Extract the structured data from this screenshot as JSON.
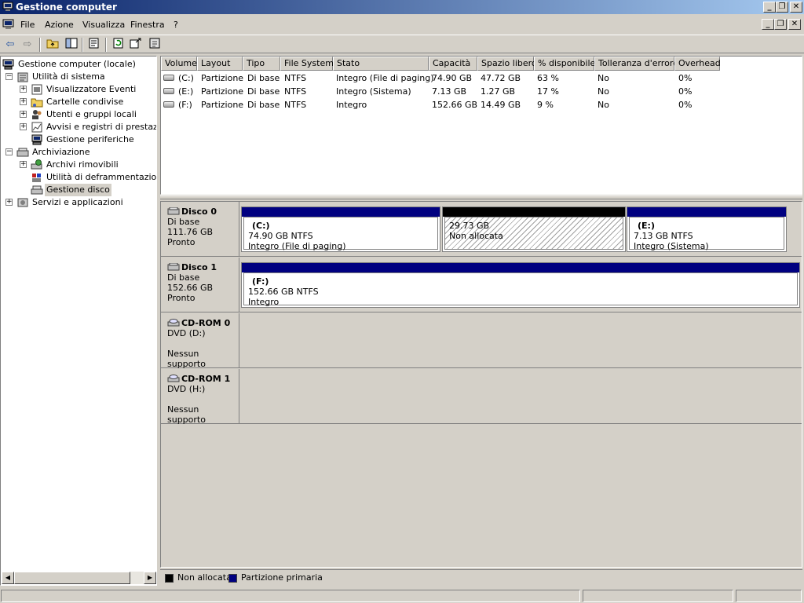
{
  "window": {
    "title": "Gestione computer"
  },
  "menu": {
    "items": [
      "File",
      "Azione",
      "Visualizza",
      "Finestra",
      "?"
    ]
  },
  "toolbar": {
    "buttons": [
      "back-icon",
      "forward-icon",
      "up-folder-icon",
      "show-tree-icon",
      "properties-icon",
      "refresh-icon",
      "export-icon",
      "help-icon"
    ]
  },
  "tree": {
    "root": "Gestione computer (locale)",
    "system_tools": "Utilità di sistema",
    "event_viewer": "Visualizzatore Eventi",
    "shared_folders": "Cartelle condivise",
    "local_users": "Utenti e gruppi locali",
    "perf_logs": "Avvisi e registri di prestazion",
    "device_manager": "Gestione periferiche",
    "storage": "Archiviazione",
    "removable_storage": "Archivi rimovibili",
    "defrag": "Utilità di deframmentazione c",
    "disk_management": "Gestione disco",
    "services": "Servizi e applicazioni"
  },
  "volume_table": {
    "headers": [
      "Volume",
      "Layout",
      "Tipo",
      "File System",
      "Stato",
      "Capacità",
      "Spazio libero",
      "% disponibile",
      "Tolleranza d'errore",
      "Overhead"
    ],
    "rows": [
      [
        "(C:)",
        "Partizione",
        "Di base",
        "NTFS",
        "Integro (File di paging)",
        "74.90 GB",
        "47.72 GB",
        "63 %",
        "No",
        "0%"
      ],
      [
        "(E:)",
        "Partizione",
        "Di base",
        "NTFS",
        "Integro (Sistema)",
        "7.13 GB",
        "1.27 GB",
        "17 %",
        "No",
        "0%"
      ],
      [
        "(F:)",
        "Partizione",
        "Di base",
        "NTFS",
        "Integro",
        "152.66 GB",
        "14.49 GB",
        "9 %",
        "No",
        "0%"
      ]
    ]
  },
  "disks": [
    {
      "name": "Disco 0",
      "type": "Di base",
      "size": "111.76 GB",
      "status": "Pronto",
      "partitions": [
        {
          "label": "(C:)",
          "size": "74.90 GB NTFS",
          "status": "Integro (File di paging)"
        },
        {
          "label": "",
          "size": "29.73 GB",
          "status": "Non allocata"
        },
        {
          "label": "(E:)",
          "size": "7.13 GB NTFS",
          "status": "Integro (Sistema)"
        }
      ]
    },
    {
      "name": "Disco 1",
      "type": "Di base",
      "size": "152.66 GB",
      "status": "Pronto",
      "partitions": [
        {
          "label": "(F:)",
          "size": "152.66 GB NTFS",
          "status": "Integro"
        }
      ]
    },
    {
      "name": "CD-ROM 0",
      "type": "DVD (D:)",
      "size": "",
      "status": "Nessun supporto"
    },
    {
      "name": "CD-ROM 1",
      "type": "DVD (H:)",
      "size": "",
      "status": "Nessun supporto"
    }
  ],
  "legend": {
    "unallocated": "Non allocata",
    "primary": "Partizione primaria"
  },
  "colors": {
    "title_start": "#0a246a",
    "title_end": "#a6caf0",
    "primary_partition": "#000080",
    "unallocated": "#000000",
    "face": "#d4d0c8"
  }
}
